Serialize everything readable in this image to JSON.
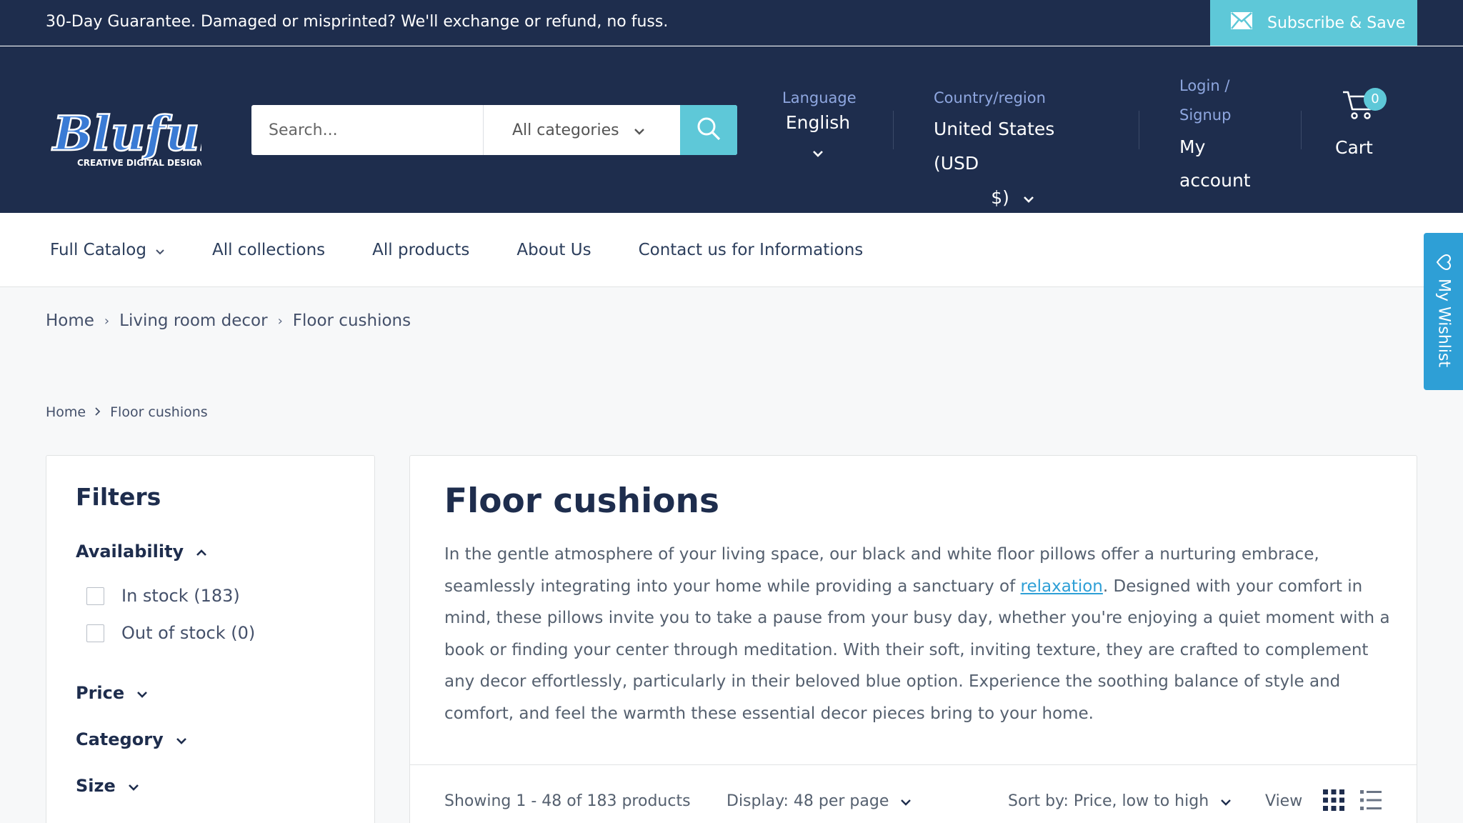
{
  "announcement": {
    "text": "30-Day Guarantee. Damaged or misprinted? We'll exchange or refund, no fuss.",
    "subscribe_label": "Subscribe & Save"
  },
  "header": {
    "logo_text": "Blufulli",
    "logo_tagline": "CREATIVE DIGITAL DESIGNS",
    "search_placeholder": "Search...",
    "category_select": "All categories",
    "language_label": "Language",
    "language_value": "English",
    "country_label": "Country/region",
    "country_value_line1": "United States (USD",
    "country_value_line2": "$)",
    "login_line1": "Login /",
    "login_line2": "Signup",
    "account_line1": "My",
    "account_line2": "account",
    "cart_count": "0",
    "cart_label": "Cart"
  },
  "nav": {
    "items": [
      "Full Catalog",
      "All collections",
      "All products",
      "About Us",
      "Contact us for Informations"
    ]
  },
  "wishlist": {
    "label": "My Wishlist"
  },
  "breadcrumbs_top": [
    "Home",
    "Living room decor",
    "Floor cushions"
  ],
  "breadcrumbs_page": [
    "Home",
    "Floor cushions"
  ],
  "filters": {
    "title": "Filters",
    "availability": "Availability",
    "options": [
      "In stock (183)",
      "Out of stock (0)"
    ],
    "price": "Price",
    "category": "Category",
    "size": "Size"
  },
  "main": {
    "title": "Floor cushions",
    "desc_before": "In the gentle atmosphere of your living space, our black and white floor pillows offer a nurturing embrace, seamlessly integrating into your home while providing a sanctuary of ",
    "desc_link": "relaxation",
    "desc_after": ". Designed with your comfort in mind, these pillows invite you to take a pause from your busy day, whether you're enjoying a quiet moment with a book or finding your center through meditation. With their soft, inviting texture, they are crafted to complement any decor effortlessly, particularly in their beloved blue option. Experience the soothing balance of style and comfort, and feel the warmth these essential decor pieces bring to your home.",
    "showing": "Showing 1 - 48 of 183 products",
    "display": "Display: 48 per page",
    "sort": "Sort by: Price, low to high",
    "view_label": "View"
  },
  "colors": {
    "header_bg": "#1e2d4d",
    "accent": "#5ec8d8",
    "wishlist": "#2e9fd6",
    "label_blue": "#8fa7e0"
  },
  "icons": {
    "subscribe": "mail-icon",
    "search": "search-icon",
    "cart": "cart-icon",
    "wishlist": "heart-icon",
    "view_grid": "grid-view-icon",
    "view_list": "list-view-icon"
  }
}
